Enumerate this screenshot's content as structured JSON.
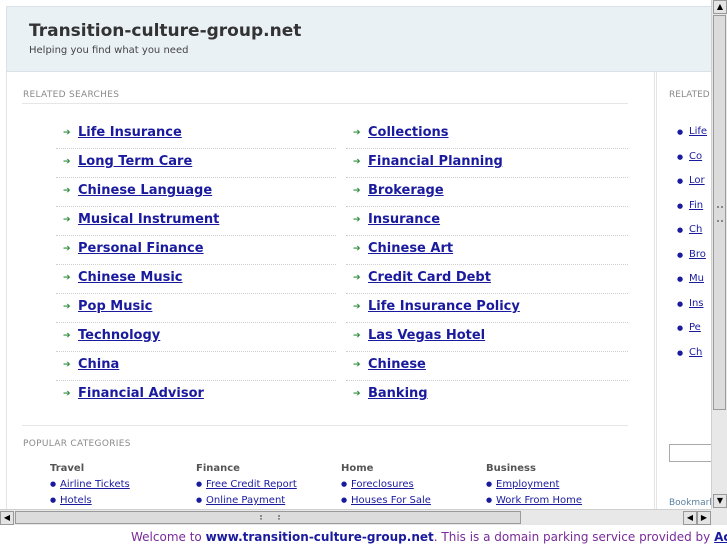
{
  "header": {
    "title": "Transition-culture-group.net",
    "tagline": "Helping you find what you need"
  },
  "related_searches": {
    "label": "RELATED SEARCHES",
    "left": [
      "Life Insurance",
      "Long Term Care",
      "Chinese Language",
      "Musical Instrument",
      "Personal Finance",
      "Chinese Music",
      "Pop Music",
      "Technology",
      "China",
      "Financial Advisor"
    ],
    "right": [
      "Collections",
      "Financial Planning",
      "Brokerage",
      "Insurance",
      "Chinese Art",
      "Credit Card Debt",
      "Life Insurance Policy",
      "Las Vegas Hotel",
      "Chinese",
      "Banking"
    ]
  },
  "popular_categories": {
    "label": "POPULAR CATEGORIES",
    "columns": [
      {
        "title": "Travel",
        "items": [
          "Airline Tickets",
          "Hotels"
        ]
      },
      {
        "title": "Finance",
        "items": [
          "Free Credit Report",
          "Online Payment"
        ]
      },
      {
        "title": "Home",
        "items": [
          "Foreclosures",
          "Houses For Sale"
        ]
      },
      {
        "title": "Business",
        "items": [
          "Employment",
          "Work From Home"
        ]
      }
    ]
  },
  "right_panel": {
    "label": "RELATED",
    "items": [
      "Life",
      "Co",
      "Lor",
      "Fin",
      "Ch",
      "Bro",
      "Mu",
      "Ins",
      "Pe",
      "Ch"
    ],
    "bookmark": "Bookmark"
  },
  "scrollbar": {
    "up": "▲",
    "down": "▼",
    "left": "◀",
    "right": "▶"
  },
  "footer": {
    "prefix": "Welcome to ",
    "domain": "www.transition-culture-group.net",
    "middle": ". This is a domain parking service provided by ",
    "provider": "Active-"
  }
}
